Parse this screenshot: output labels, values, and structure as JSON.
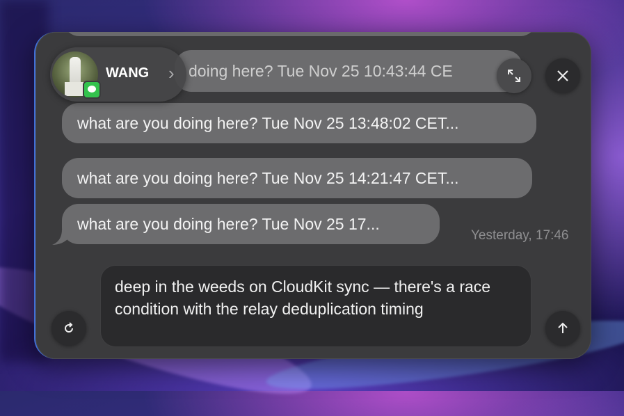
{
  "contact": {
    "name": "WANG"
  },
  "messages": [
    {
      "text": "doing here? Tue Nov 25 10:43:44 CE"
    },
    {
      "text": "what are you doing here? Tue Nov 25 13:48:02 CET..."
    },
    {
      "text": "what are you doing here? Tue Nov 25 14:21:47 CET..."
    },
    {
      "text": "what are you doing here? Tue Nov 25 17..."
    }
  ],
  "timestamp": "Yesterday, 17:46",
  "compose": {
    "text": "deep in the weeds on CloudKit sync — there's a race condition with the relay deduplication timing"
  },
  "icons": {
    "expand": "expand-icon",
    "close": "close-icon",
    "refresh": "refresh-icon",
    "send": "send-arrow-icon",
    "chevron": "chevron-right-icon",
    "messages_badge": "messages-app-icon"
  },
  "colors": {
    "panel": "#3b3b3d",
    "bubble": "#6c6c6e",
    "input": "#2a2a2c",
    "badge_green": "#33c24d"
  }
}
